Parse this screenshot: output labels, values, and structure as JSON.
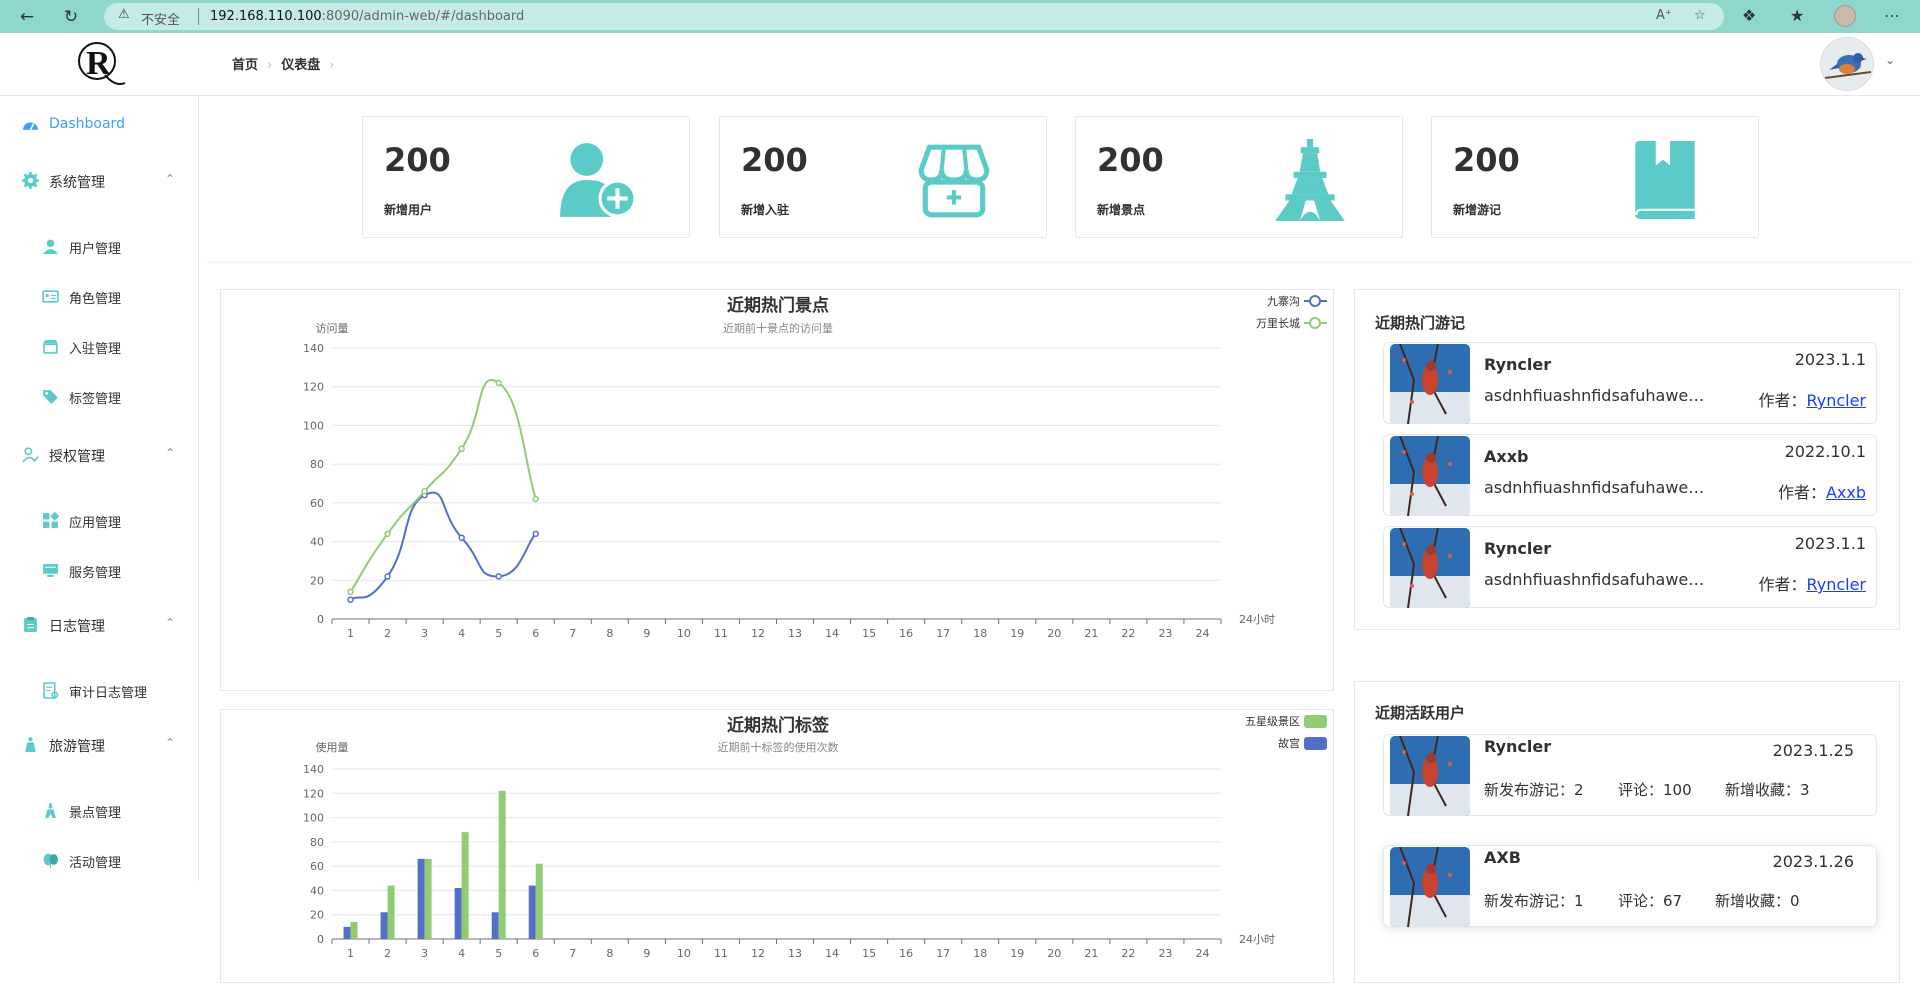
{
  "browser": {
    "insecure_label": "不安全",
    "url_host": "192.168.110.100",
    "url_path": ":8090/admin-web/#/dashboard"
  },
  "header": {
    "breadcrumb": [
      "首页",
      "仪表盘"
    ]
  },
  "sidebar": {
    "items": [
      {
        "label": "Dashboard",
        "icon": "dashboard-icon",
        "active": true
      },
      {
        "label": "系统管理",
        "icon": "gear-icon",
        "expanded": true,
        "children": [
          {
            "label": "用户管理",
            "icon": "user-icon"
          },
          {
            "label": "角色管理",
            "icon": "id-card-icon"
          },
          {
            "label": "入驻管理",
            "icon": "store-icon"
          },
          {
            "label": "标签管理",
            "icon": "tag-icon"
          }
        ]
      },
      {
        "label": "授权管理",
        "icon": "user-check-icon",
        "expanded": true,
        "children": [
          {
            "label": "应用管理",
            "icon": "apps-icon"
          },
          {
            "label": "服务管理",
            "icon": "server-icon"
          }
        ]
      },
      {
        "label": "日志管理",
        "icon": "clipboard-icon",
        "expanded": true,
        "children": [
          {
            "label": "审计日志管理",
            "icon": "audit-icon"
          }
        ]
      },
      {
        "label": "旅游管理",
        "icon": "traveler-icon",
        "expanded": true,
        "children": [
          {
            "label": "景点管理",
            "icon": "landmark-icon"
          },
          {
            "label": "活动管理",
            "icon": "balloon-icon"
          }
        ]
      }
    ]
  },
  "stats": [
    {
      "value": "200",
      "label": "新增用户",
      "icon": "add-user-icon"
    },
    {
      "value": "200",
      "label": "新增入驻",
      "icon": "shop-icon"
    },
    {
      "value": "200",
      "label": "新增景点",
      "icon": "eiffel-tower-icon"
    },
    {
      "value": "200",
      "label": "新增游记",
      "icon": "book-icon"
    }
  ],
  "colors": {
    "accent": "#409eff",
    "teal": "#5ccbc8",
    "series_blue": "#5470c6",
    "series_green": "#91cc75"
  },
  "chart_data": [
    {
      "type": "line",
      "title": "近期热门景点",
      "subtitle": "近期前十景点的访问量",
      "ylabel": "访问量",
      "xlabel": "24小时",
      "ylim": [
        0,
        140
      ],
      "y_ticks": [
        0,
        20,
        40,
        60,
        80,
        100,
        120,
        140
      ],
      "categories": [
        "1",
        "2",
        "3",
        "4",
        "5",
        "6",
        "7",
        "8",
        "9",
        "10",
        "11",
        "12",
        "13",
        "14",
        "15",
        "16",
        "17",
        "18",
        "19",
        "20",
        "21",
        "22",
        "23",
        "24"
      ],
      "smooth": true,
      "legend_position": "top-right",
      "series": [
        {
          "name": "九寨沟",
          "values": [
            10,
            22,
            64,
            42,
            22,
            44
          ]
        },
        {
          "name": "万里长城",
          "values": [
            14,
            44,
            66,
            88,
            122,
            62
          ]
        }
      ]
    },
    {
      "type": "bar",
      "title": "近期热门标签",
      "subtitle": "近期前十标签的使用次数",
      "ylabel": "使用量",
      "xlabel": "24小时",
      "ylim": [
        0,
        140
      ],
      "y_ticks": [
        0,
        20,
        40,
        60,
        80,
        100,
        120,
        140
      ],
      "categories": [
        "1",
        "2",
        "3",
        "4",
        "5",
        "6",
        "7",
        "8",
        "9",
        "10",
        "11",
        "12",
        "13",
        "14",
        "15",
        "16",
        "17",
        "18",
        "19",
        "20",
        "21",
        "22",
        "23",
        "24"
      ],
      "legend_position": "top-right",
      "series": [
        {
          "name": "五星级景区",
          "values": [
            14,
            44,
            66,
            88,
            122,
            62
          ]
        },
        {
          "name": "故宫",
          "values": [
            10,
            22,
            66,
            42,
            22,
            44
          ]
        }
      ]
    }
  ],
  "hot_travels": {
    "title": "近期热门游记",
    "author_label": "作者：",
    "items": [
      {
        "name": "Ryncler",
        "date": "2023.1.1",
        "desc": "asdnhfiuashnfidsafuhaweho...",
        "author": "Ryncler"
      },
      {
        "name": "Axxb",
        "date": "2022.10.1",
        "desc": "asdnhfiuashnfidsafuhaweho...",
        "author": "Axxb"
      },
      {
        "name": "Ryncler",
        "date": "2023.1.1",
        "desc": "asdnhfiuashnfidsafuhaweho...",
        "author": "Ryncler"
      }
    ]
  },
  "active_users": {
    "title": "近期活跃用户",
    "items": [
      {
        "name": "Ryncler",
        "date": "2023.1.25",
        "posts": "新发布游记：2",
        "comments": "评论：100",
        "favorites": "新增收藏：3"
      },
      {
        "name": "AXB",
        "date": "2023.1.26",
        "posts": "新发布游记：1",
        "comments": "评论：67",
        "favorites": "新增收藏：0"
      }
    ]
  }
}
